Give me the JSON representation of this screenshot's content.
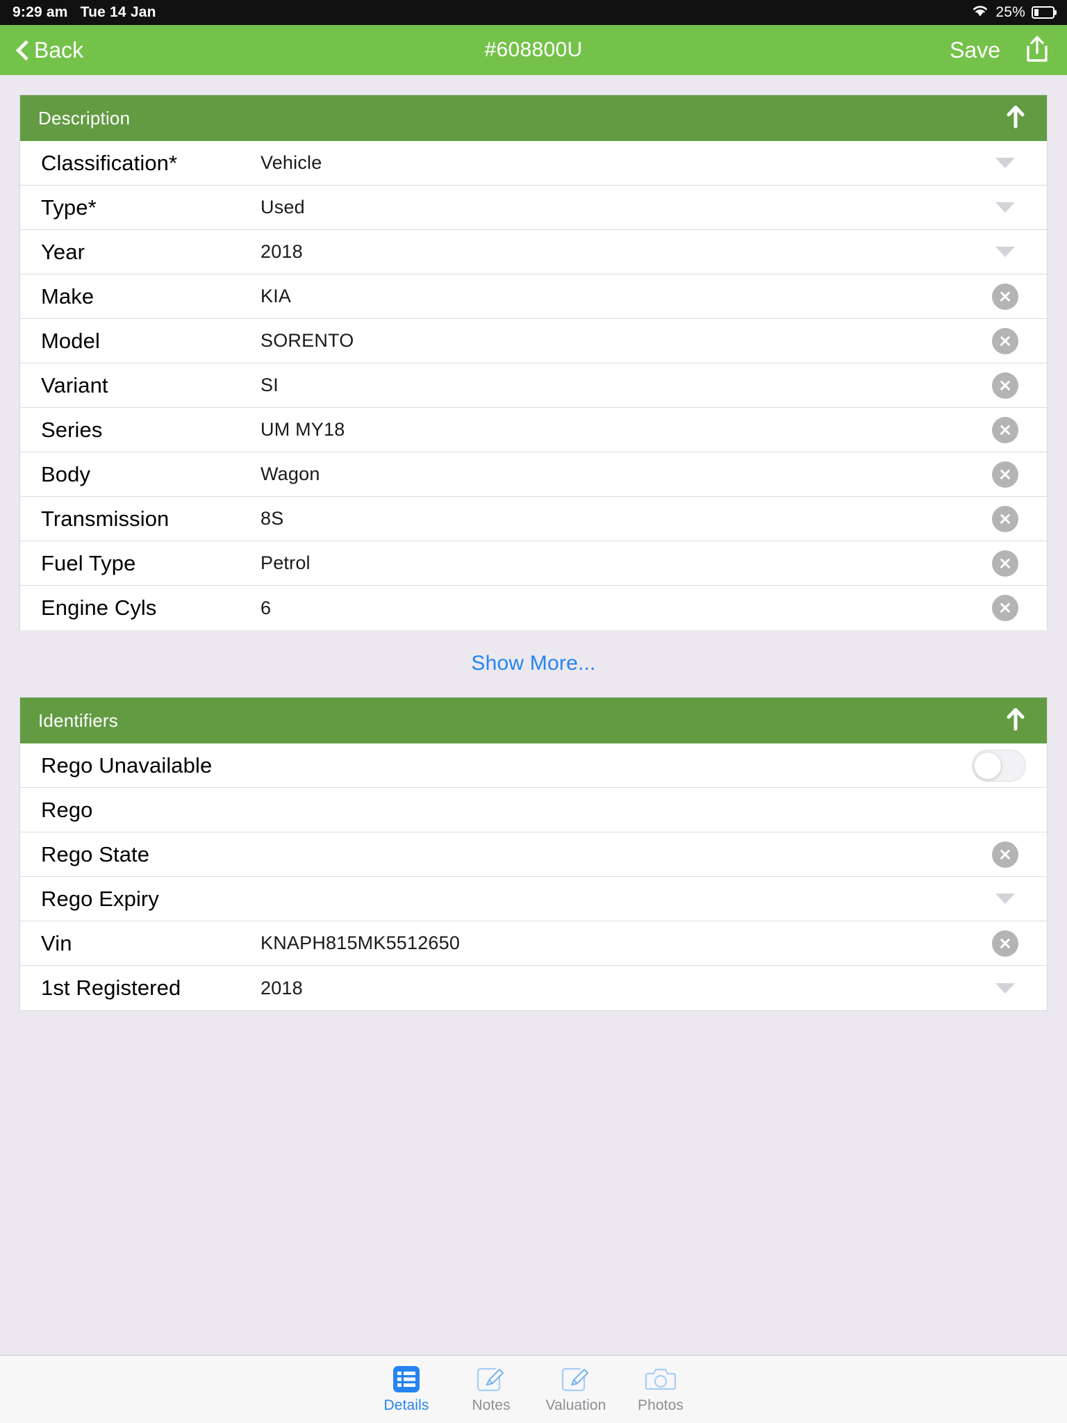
{
  "status_bar": {
    "time": "9:29 am",
    "date": "Tue 14 Jan",
    "wifi_icon": "wifi-icon",
    "battery_percent": "25%",
    "battery_level": 25
  },
  "nav_bar": {
    "back_label": "Back",
    "back_icon": "chevron-left-icon",
    "title": "#608800U",
    "save_label": "Save",
    "share_icon": "share-icon",
    "background_color": "#74c24a"
  },
  "sections": [
    {
      "title": "Description",
      "collapse_icon": "arrow-up-icon",
      "header_color": "#639b43",
      "rows": [
        {
          "label": "Classification*",
          "value": "Vehicle",
          "accessory": "caret"
        },
        {
          "label": "Type*",
          "value": "Used",
          "accessory": "caret"
        },
        {
          "label": "Year",
          "value": "2018",
          "accessory": "caret"
        },
        {
          "label": "Make",
          "value": "KIA",
          "accessory": "clear"
        },
        {
          "label": "Model",
          "value": "SORENTO",
          "accessory": "clear"
        },
        {
          "label": "Variant",
          "value": "SI",
          "accessory": "clear"
        },
        {
          "label": "Series",
          "value": "UM MY18",
          "accessory": "clear"
        },
        {
          "label": "Body",
          "value": "Wagon",
          "accessory": "clear"
        },
        {
          "label": "Transmission",
          "value": "8S",
          "accessory": "clear"
        },
        {
          "label": "Fuel Type",
          "value": "Petrol",
          "accessory": "clear"
        },
        {
          "label": "Engine Cyls",
          "value": "6",
          "accessory": "clear"
        }
      ]
    },
    {
      "title": "Identifiers",
      "collapse_icon": "arrow-up-icon",
      "header_color": "#639b43",
      "rows": [
        {
          "label": "Rego Unavailable",
          "value": "",
          "accessory": "toggle"
        },
        {
          "label": "Rego",
          "value": "",
          "accessory": "none"
        },
        {
          "label": "Rego State",
          "value": "",
          "accessory": "clear"
        },
        {
          "label": "Rego Expiry",
          "value": "",
          "accessory": "caret"
        },
        {
          "label": "Vin",
          "value": "KNAPH815MK5512650",
          "accessory": "clear"
        },
        {
          "label": "1st Registered",
          "value": "2018",
          "accessory": "caret"
        }
      ]
    }
  ],
  "show_more": {
    "label": "Show More...",
    "color": "#2684f0"
  },
  "tab_bar": {
    "active_color": "#2684f0",
    "inactive_color": "#8e8e93",
    "tabs": [
      {
        "label": "Details",
        "icon": "list-icon",
        "active": true
      },
      {
        "label": "Notes",
        "icon": "note-edit-icon",
        "active": false
      },
      {
        "label": "Valuation",
        "icon": "note-edit-icon",
        "active": false
      },
      {
        "label": "Photos",
        "icon": "camera-icon",
        "active": false
      }
    ]
  }
}
